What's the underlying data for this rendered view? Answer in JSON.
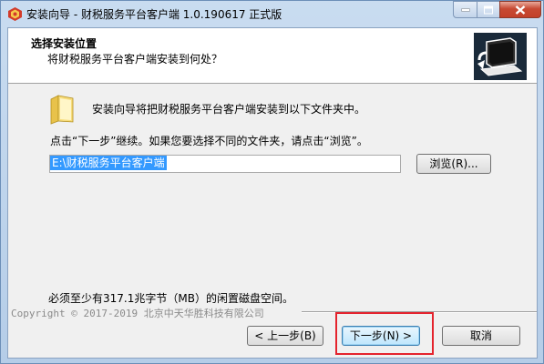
{
  "window": {
    "title": "安装向导 - 财税服务平台客户端 1.0.190617 正式版",
    "icons": {
      "app": "app-icon",
      "minimize": "minimize-icon",
      "maximize": "maximize-icon",
      "close": "close-icon"
    }
  },
  "header": {
    "title": "选择安装位置",
    "subtitle": "将财税服务平台客户端安装到何处？",
    "image_icon": "computer-install-icon"
  },
  "body": {
    "folder_icon": "folder-icon",
    "description": "安装向导将把财税服务平台客户端安装到以下文件夹中。",
    "instruction": "点击“下一步”继续。如果您要选择不同的文件夹，请点击“浏览”。",
    "path_value": "E:\\财税服务平台客户端",
    "browse_label": "浏览(R)...",
    "space_required": "必须至少有317.1兆字节（MB）的闲置磁盘空间。"
  },
  "footer": {
    "copyright": "Copyright © 2017-2019 北京中天华胜科技有限公司",
    "back_label": "< 上一步(B)",
    "next_label": "下一步(N) >",
    "cancel_label": "取消"
  },
  "colors": {
    "selection": "#3399ff",
    "highlight": "#e4232d",
    "close_button": "#c74a33"
  }
}
